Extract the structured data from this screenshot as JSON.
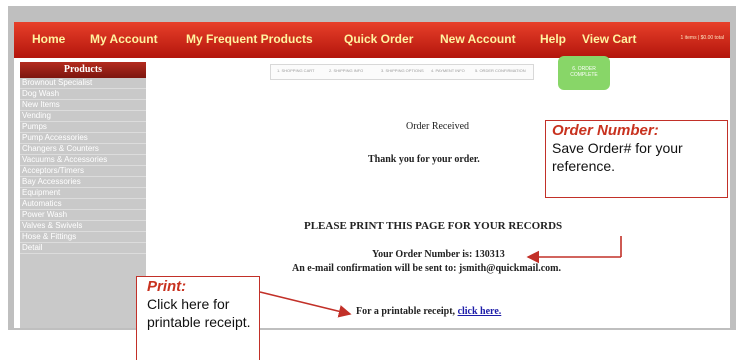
{
  "nav": {
    "items": [
      "Home",
      "My Account",
      "My Frequent Products",
      "Quick Order",
      "New Account",
      "Help",
      "View Cart"
    ],
    "cart_summary": "1 items | $0.00 total"
  },
  "sidebar": {
    "title": "Products",
    "items": [
      "Brownout Specialist",
      "Dog Wash",
      "New Items",
      "Vending",
      "Pumps",
      "Pump Accessories",
      "Changers & Counters",
      "Vacuums & Accessories",
      "Acceptors/Timers",
      "Bay Accessories",
      "Equipment",
      "Automatics",
      "Power Wash",
      "Valves & Swivels",
      "Hose & Fittings",
      "Detail"
    ]
  },
  "checkout_steps": {
    "steps": [
      "1. SHOPPING CART",
      "2. SHIPPING INFO",
      "3. SHIPPING OPTIONS",
      "4. PAYMENT INFO",
      "5. ORDER CONFIRMATION"
    ],
    "active": "6. ORDER COMPLETE"
  },
  "main": {
    "order_received": "Order Received",
    "thank_you": "Thank you for your order.",
    "print_notice": "PLEASE PRINT THIS PAGE FOR YOUR RECORDS",
    "order_number_text": "Your Order Number is: 130313",
    "email_confirmation": "An e-mail confirmation will be sent to: jsmith@quickmail.com.",
    "receipt_prefix": "For a printable receipt,",
    "receipt_link": "click here."
  },
  "callouts": {
    "order_number": {
      "title": "Order Number:",
      "body": "Save Order# for your reference."
    },
    "print": {
      "title": "Print:",
      "body": "Click here for printable receipt."
    }
  },
  "colors": {
    "nav_red": "#c8251a",
    "nav_text": "#fff3a0",
    "callout_red": "#c8321f",
    "active_step": "#88d668"
  }
}
